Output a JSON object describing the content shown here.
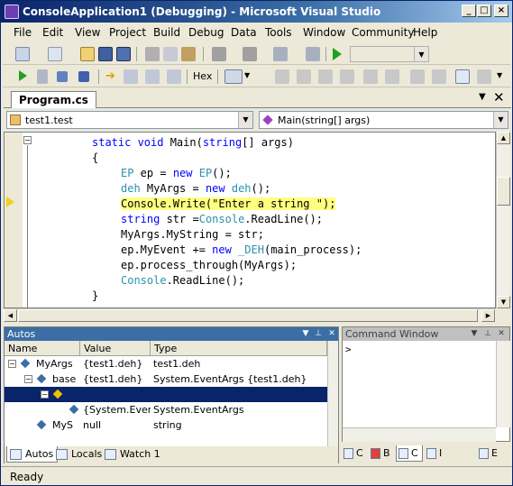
{
  "window": {
    "title": "ConsoleApplication1 (Debugging) - Microsoft Visual Studio"
  },
  "menu": [
    "File",
    "Edit",
    "View",
    "Project",
    "Build",
    "Debug",
    "Data",
    "Tools",
    "Window",
    "Community",
    "Help"
  ],
  "toolbar": {
    "hex_label": "Hex"
  },
  "document": {
    "tab": "Program.cs",
    "class_combo": "test1.test",
    "member_combo": "Main(string[] args)"
  },
  "code": {
    "lines": [
      {
        "indent": 0,
        "parts": [
          {
            "t": "static ",
            "c": "kw"
          },
          {
            "t": "void ",
            "c": "kw"
          },
          {
            "t": "Main(",
            "c": ""
          },
          {
            "t": "string",
            "c": "kw"
          },
          {
            "t": "[] args)",
            "c": ""
          }
        ]
      },
      {
        "indent": 0,
        "parts": [
          {
            "t": "{",
            "c": ""
          }
        ]
      },
      {
        "indent": 1,
        "parts": [
          {
            "t": "EP",
            "c": "ty"
          },
          {
            "t": " ep = ",
            "c": ""
          },
          {
            "t": "new ",
            "c": "kw"
          },
          {
            "t": "EP",
            "c": "ty"
          },
          {
            "t": "();",
            "c": ""
          }
        ]
      },
      {
        "indent": 1,
        "parts": [
          {
            "t": "deh",
            "c": "ty"
          },
          {
            "t": " MyArgs = ",
            "c": ""
          },
          {
            "t": "new ",
            "c": "kw"
          },
          {
            "t": "deh",
            "c": "ty"
          },
          {
            "t": "();",
            "c": ""
          }
        ]
      },
      {
        "indent": 1,
        "highlight": true,
        "parts": [
          {
            "t": "Console.Write(\"Enter a string \");",
            "c": ""
          }
        ]
      },
      {
        "indent": 1,
        "parts": [
          {
            "t": "string",
            "c": "kw"
          },
          {
            "t": " str =",
            "c": ""
          },
          {
            "t": "Console",
            "c": "ty"
          },
          {
            "t": ".ReadLine();",
            "c": ""
          }
        ]
      },
      {
        "indent": 1,
        "parts": [
          {
            "t": "MyArgs.MyString = str;",
            "c": ""
          }
        ]
      },
      {
        "indent": 1,
        "parts": [
          {
            "t": "ep.MyEvent += ",
            "c": ""
          },
          {
            "t": "new ",
            "c": "kw"
          },
          {
            "t": "_DEH",
            "c": "ty"
          },
          {
            "t": "(main_process);",
            "c": ""
          }
        ]
      },
      {
        "indent": 1,
        "parts": [
          {
            "t": "ep.process_through(MyArgs);",
            "c": ""
          }
        ]
      },
      {
        "indent": 1,
        "parts": [
          {
            "t": "Console",
            "c": "ty"
          },
          {
            "t": ".ReadLine();",
            "c": ""
          }
        ]
      },
      {
        "indent": 0,
        "parts": [
          {
            "t": "}",
            "c": ""
          }
        ]
      }
    ]
  },
  "autos": {
    "title": "Autos",
    "columns": [
      "Name",
      "Value",
      "Type"
    ],
    "rows": [
      {
        "name": "MyArgs",
        "value": "{test1.deh}",
        "type": "test1.deh",
        "level": 0,
        "exp": "−"
      },
      {
        "name": "base",
        "value": "{test1.deh}",
        "type": "System.EventArgs {test1.deh}",
        "level": 1,
        "exp": "−"
      },
      {
        "name": "",
        "value": "",
        "type": "",
        "level": 2,
        "exp": "−",
        "selected": true
      },
      {
        "name": "",
        "value": "{System.EventA",
        "type": "System.EventArgs",
        "level": 3,
        "exp": ""
      },
      {
        "name": "MyS",
        "value": "null",
        "type": "string",
        "level": 1,
        "exp": ""
      }
    ],
    "tabs": [
      "Autos",
      "Locals",
      "Watch 1"
    ]
  },
  "command_window": {
    "title": "Command Window",
    "prompt": ">"
  },
  "right_tabs": [
    "C",
    "B",
    "C",
    "I",
    "E"
  ],
  "status": "Ready"
}
